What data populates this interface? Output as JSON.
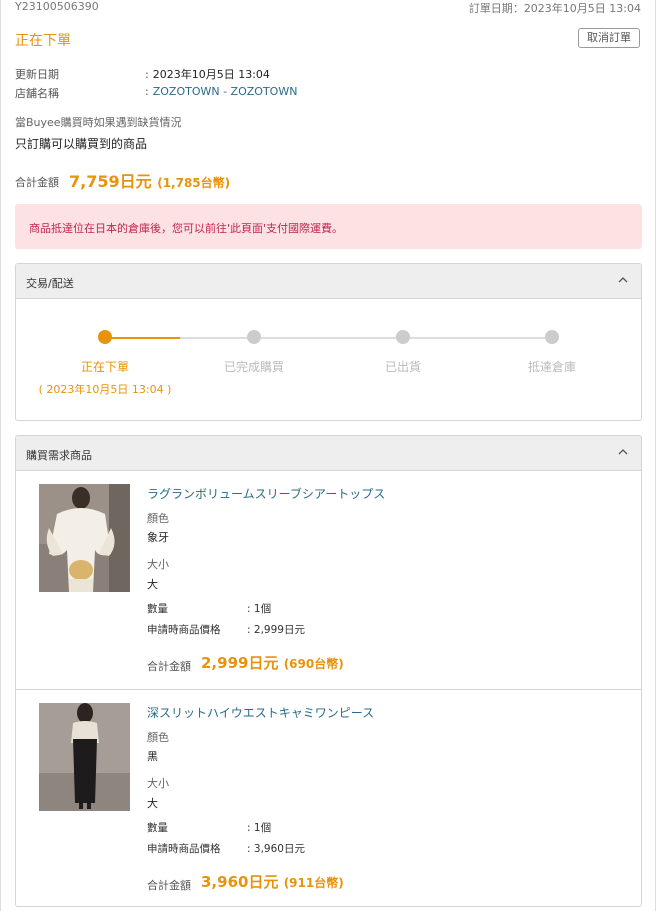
{
  "order": {
    "id": "Y23100506390",
    "date_label": "訂單日期",
    "date_value": "2023年10月5日 13:04",
    "status": "正在下單",
    "cancel_label": "取消訂單"
  },
  "info": {
    "updated_label": "更新日期",
    "updated_value": "2023年10月5日 13:04",
    "store_label": "店舖名稱",
    "store_value": "ZOZOTOWN - ZOZOTOWN"
  },
  "stock_policy": {
    "label": "當Buyee購買時如果遇到缺貨情況",
    "value": "只訂購可以購買到的商品"
  },
  "total": {
    "label": "合計金額",
    "amount": "7,759日元",
    "twd": "(1,785台幣)"
  },
  "alert": "商品抵達位在日本的倉庫後，您可以前往'此頁面'支付國際運費。",
  "shipping_panel": {
    "title": "交易/配送",
    "steps": [
      {
        "label": "正在下單",
        "active": true
      },
      {
        "label": "已完成購買",
        "active": false
      },
      {
        "label": "已出貨",
        "active": false
      },
      {
        "label": "抵達倉庫",
        "active": false
      }
    ],
    "active_date": "( 2023年10月5日 13:04 )",
    "progress_completed_segments": 0.5
  },
  "items_panel": {
    "title": "購買需求商品",
    "items": [
      {
        "name": "ラグランボリュームスリーブシアートップス",
        "color_label": "顏色",
        "color_value": "象牙",
        "size_label": "大小",
        "size_value": "大",
        "qty_label": "數量",
        "qty_value": "1個",
        "price_label": "申請時商品價格",
        "price_value": "2,999日元",
        "total_label": "合計金額",
        "total_amount": "2,999日元",
        "total_twd": "(690台幣)"
      },
      {
        "name": "深スリットハイウエストキャミワンピース",
        "color_label": "顏色",
        "color_value": "黑",
        "size_label": "大小",
        "size_value": "大",
        "qty_label": "數量",
        "qty_value": "1個",
        "price_label": "申請時商品價格",
        "price_value": "3,960日元",
        "total_label": "合計金額",
        "total_amount": "3,960日元",
        "total_twd": "(911台幣)"
      }
    ]
  },
  "colors": {
    "accent": "#e8930c",
    "link": "#2a6a8a",
    "alert_bg": "#fde2e4",
    "alert_text": "#c0264b"
  }
}
